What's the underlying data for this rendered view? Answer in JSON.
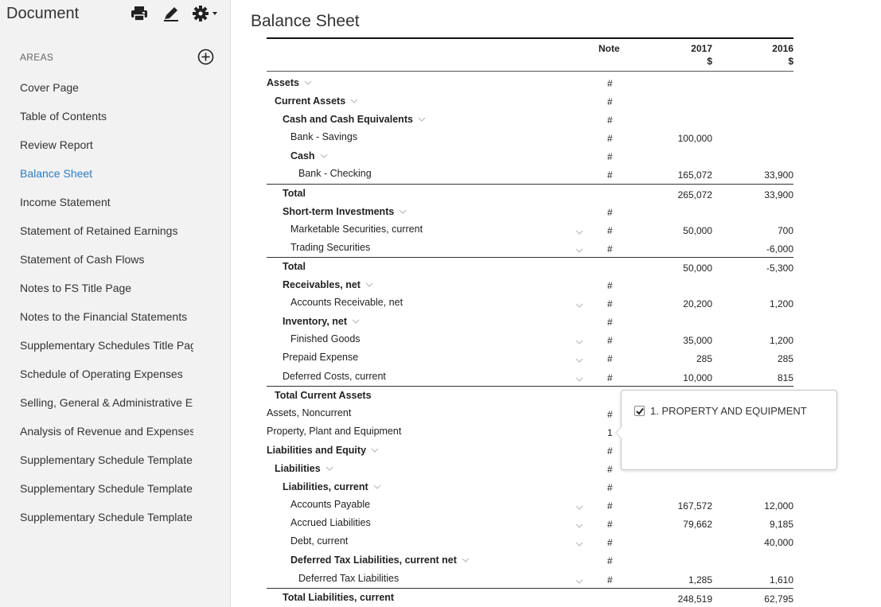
{
  "sidebar": {
    "title": "Document",
    "areas_label": "AREAS",
    "items": [
      {
        "label": "Cover Page",
        "active": false
      },
      {
        "label": "Table of Contents",
        "active": false
      },
      {
        "label": "Review Report",
        "active": false
      },
      {
        "label": "Balance Sheet",
        "active": true
      },
      {
        "label": "Income Statement",
        "active": false
      },
      {
        "label": "Statement of Retained Earnings",
        "active": false
      },
      {
        "label": "Statement of Cash Flows",
        "active": false
      },
      {
        "label": "Notes to FS Title Page",
        "active": false
      },
      {
        "label": "Notes to the Financial Statements",
        "active": false
      },
      {
        "label": "Supplementary Schedules Title Pag",
        "active": false
      },
      {
        "label": "Schedule of Operating Expenses",
        "active": false
      },
      {
        "label": "Selling, General & Administrative E",
        "active": false
      },
      {
        "label": "Analysis of Revenue and Expenses",
        "active": false
      },
      {
        "label": "Supplementary Schedule Template",
        "active": false
      },
      {
        "label": "Supplementary Schedule Template",
        "active": false
      },
      {
        "label": "Supplementary Schedule Template",
        "active": false
      }
    ],
    "icons": [
      "print-icon",
      "pencil-icon",
      "gear-icon",
      "add-circle-icon"
    ]
  },
  "main": {
    "title": "Balance Sheet",
    "headers": {
      "note": "Note",
      "y2017": "2017",
      "y2016": "2016",
      "unit": "$"
    },
    "rows": [
      {
        "label": "Assets",
        "indent": 0,
        "bold": true,
        "chev": true,
        "note": "#",
        "v2017": "",
        "v2016": ""
      },
      {
        "label": "Current Assets",
        "indent": 1,
        "bold": true,
        "chev": true,
        "note": "#",
        "v2017": "",
        "v2016": ""
      },
      {
        "label": "Cash and Cash Equivalents",
        "indent": 2,
        "bold": true,
        "chev": true,
        "note": "#",
        "v2017": "",
        "v2016": ""
      },
      {
        "label": "Bank - Savings",
        "indent": 3,
        "bold": false,
        "chev": false,
        "note": "#",
        "v2017": "100,000",
        "v2016": ""
      },
      {
        "label": "Cash",
        "indent": 3,
        "bold": true,
        "chev": true,
        "note": "#",
        "v2017": "",
        "v2016": ""
      },
      {
        "label": "Bank - Checking",
        "indent": 4,
        "bold": false,
        "chev": false,
        "note": "#",
        "v2017": "165,072",
        "v2016": "33,900"
      },
      {
        "label": "Total",
        "indent": 2,
        "bold": true,
        "total": true,
        "note": "",
        "v2017": "265,072",
        "v2016": "33,900"
      },
      {
        "label": "Short-term Investments",
        "indent": 2,
        "bold": true,
        "chev": true,
        "note": "#",
        "v2017": "",
        "v2016": ""
      },
      {
        "label": "Marketable Securities, current",
        "indent": 3,
        "bold": false,
        "rchev": true,
        "note": "#",
        "v2017": "50,000",
        "v2016": "700"
      },
      {
        "label": "Trading Securities",
        "indent": 3,
        "bold": false,
        "rchev": true,
        "note": "#",
        "v2017": "",
        "v2016": "-6,000"
      },
      {
        "label": "Total",
        "indent": 2,
        "bold": true,
        "total": true,
        "note": "",
        "v2017": "50,000",
        "v2016": "-5,300"
      },
      {
        "label": "Receivables, net",
        "indent": 2,
        "bold": true,
        "chev": true,
        "note": "#",
        "v2017": "",
        "v2016": ""
      },
      {
        "label": "Accounts Receivable, net",
        "indent": 3,
        "bold": false,
        "rchev": true,
        "note": "#",
        "v2017": "20,200",
        "v2016": "1,200"
      },
      {
        "label": "Inventory, net",
        "indent": 2,
        "bold": true,
        "chev": true,
        "note": "#",
        "v2017": "",
        "v2016": ""
      },
      {
        "label": "Finished Goods",
        "indent": 3,
        "bold": false,
        "rchev": true,
        "note": "#",
        "v2017": "35,000",
        "v2016": "1,200"
      },
      {
        "label": "Prepaid Expense",
        "indent": 2,
        "bold": false,
        "rchev": true,
        "note": "#",
        "v2017": "285",
        "v2016": "285"
      },
      {
        "label": "Deferred Costs, current",
        "indent": 2,
        "bold": false,
        "rchev": true,
        "note": "#",
        "v2017": "10,000",
        "v2016": "815"
      },
      {
        "label": "Total Current Assets",
        "indent": 1,
        "bold": true,
        "total": true,
        "note": "",
        "v2017": "",
        "v2016": ""
      },
      {
        "label": "Assets, Noncurrent",
        "indent": 0,
        "bold": false,
        "note": "#",
        "v2017": "",
        "v2016": ""
      },
      {
        "label": "Property, Plant and Equipment",
        "indent": 0,
        "bold": false,
        "note": "1",
        "v2017": "",
        "v2016": ""
      },
      {
        "label": "Liabilities and Equity",
        "indent": 0,
        "bold": true,
        "chev": true,
        "note": "#",
        "v2017": "",
        "v2016": ""
      },
      {
        "label": "Liabilities",
        "indent": 1,
        "bold": true,
        "chev": true,
        "note": "#",
        "v2017": "",
        "v2016": ""
      },
      {
        "label": "Liabilities, current",
        "indent": 2,
        "bold": true,
        "chev": true,
        "note": "#",
        "v2017": "",
        "v2016": ""
      },
      {
        "label": "Accounts Payable",
        "indent": 3,
        "bold": false,
        "rchev": true,
        "note": "#",
        "v2017": "167,572",
        "v2016": "12,000"
      },
      {
        "label": "Accrued Liabilities",
        "indent": 3,
        "bold": false,
        "rchev": true,
        "note": "#",
        "v2017": "79,662",
        "v2016": "9,185"
      },
      {
        "label": "Debt, current",
        "indent": 3,
        "bold": false,
        "rchev": true,
        "note": "#",
        "v2017": "",
        "v2016": "40,000"
      },
      {
        "label": "Deferred Tax Liabilities, current net",
        "indent": 3,
        "bold": true,
        "chev": true,
        "note": "#",
        "v2017": "",
        "v2016": ""
      },
      {
        "label": "Deferred Tax Liabilities",
        "indent": 4,
        "bold": false,
        "rchev": true,
        "note": "#",
        "v2017": "1,285",
        "v2016": "1,610"
      },
      {
        "label": "Total Liabilities, current",
        "indent": 2,
        "bold": true,
        "total": true,
        "note": "",
        "v2017": "248,519",
        "v2016": "62,795"
      }
    ]
  },
  "popup": {
    "checked": true,
    "label": "1. PROPERTY AND EQUIPMENT"
  }
}
